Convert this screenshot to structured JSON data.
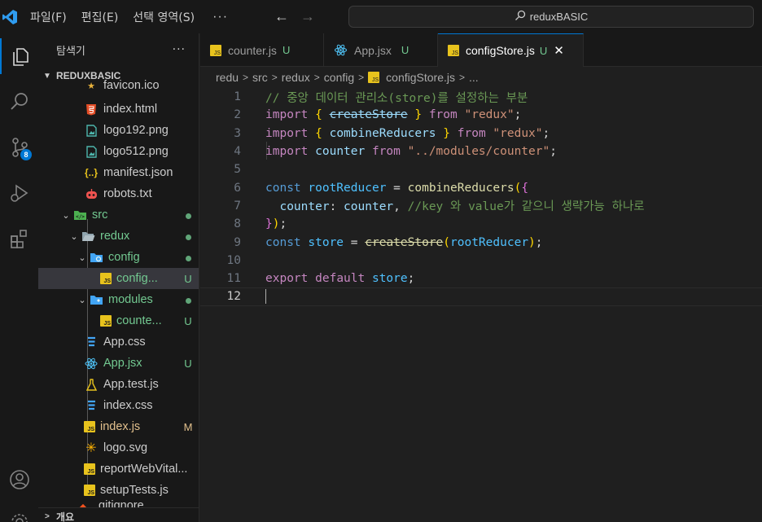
{
  "titlebar": {
    "menus": [
      "파일(F)",
      "편집(E)",
      "선택 영역(S)"
    ],
    "more": "···",
    "search": "reduxBASIC"
  },
  "activity": {
    "badge": "8"
  },
  "sidebar": {
    "title": "탐색기",
    "more": "···",
    "section": "REDUXBASIC",
    "items": [
      {
        "label": "favicon.ico",
        "status": ""
      },
      {
        "label": "index.html",
        "status": ""
      },
      {
        "label": "logo192.png",
        "status": ""
      },
      {
        "label": "logo512.png",
        "status": ""
      },
      {
        "label": "manifest.json",
        "status": ""
      },
      {
        "label": "robots.txt",
        "status": ""
      },
      {
        "label": "src",
        "status": ""
      },
      {
        "label": "redux",
        "status": ""
      },
      {
        "label": "config",
        "status": ""
      },
      {
        "label": "config...",
        "status": "U"
      },
      {
        "label": "modules",
        "status": ""
      },
      {
        "label": "counte...",
        "status": "U"
      },
      {
        "label": "App.css",
        "status": ""
      },
      {
        "label": "App.jsx",
        "status": "U"
      },
      {
        "label": "App.test.js",
        "status": ""
      },
      {
        "label": "index.css",
        "status": ""
      },
      {
        "label": "index.js",
        "status": "M"
      },
      {
        "label": "logo.svg",
        "status": ""
      },
      {
        "label": "reportWebVital...",
        "status": ""
      },
      {
        "label": "setupTests.js",
        "status": ""
      },
      {
        "label": ".gitignore",
        "status": ""
      }
    ],
    "outline": "개요"
  },
  "tabs": [
    {
      "label": "counter.js",
      "status": "U"
    },
    {
      "label": "App.jsx",
      "status": "U"
    },
    {
      "label": "configStore.js",
      "status": "U"
    }
  ],
  "breadcrumb": [
    "redu",
    "src",
    "redux",
    "config",
    "configStore.js",
    "..."
  ],
  "code": {
    "line_numbers": [
      "1",
      "2",
      "3",
      "4",
      "5",
      "6",
      "7",
      "8",
      "9",
      "10",
      "11",
      "12"
    ],
    "l1_comment": "// 중앙 데이터 관리소(store)를 설정하는 부분",
    "kw_import": "import",
    "createStore": "createStore",
    "combineReducers": "combineReducers",
    "counter": "counter",
    "from": "from",
    "str_redux": "\"redux\"",
    "str_counter": "\"../modules/counter\"",
    "kw_const": "const",
    "rootReducer": "rootReducer",
    "store": "store",
    "l7_key": "counter",
    "l7_comment": "//key 와 value가 같으니 생략가능 하나로",
    "kw_export": "export",
    "kw_default": "default"
  }
}
